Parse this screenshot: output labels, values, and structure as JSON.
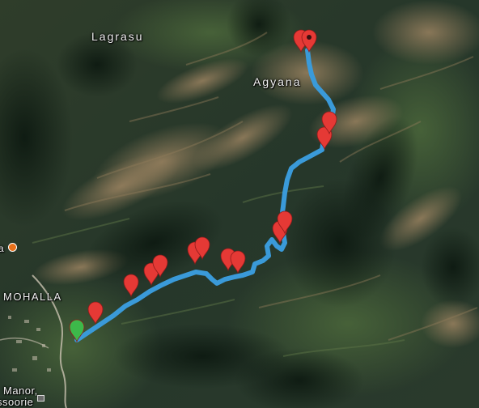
{
  "map": {
    "view": "satellite",
    "place_labels": {
      "lagrasu": "Lagrasu",
      "agyana": "Agyana",
      "mohalla": "MOHALLA",
      "manor": "Manor,",
      "mussoorie": "ssoorie",
      "edge_a": "a"
    },
    "route": {
      "color": "#3a9ad9",
      "start_marker_color": "#3db84a",
      "end_marker_color": "#e53935"
    },
    "waypoints": {
      "count": 17,
      "color": "#e53935"
    },
    "poi": {
      "orange_dot_color": "#e8701a"
    }
  }
}
